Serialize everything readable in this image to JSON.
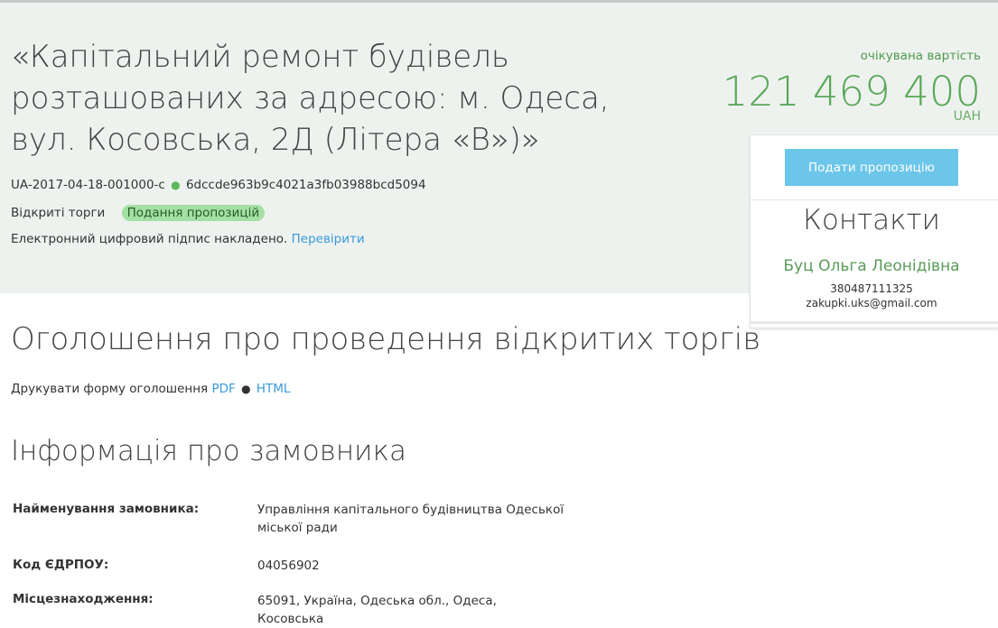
{
  "tender": {
    "title": "«Капітальний ремонт будівель розташованих за адресою: м. Одеса, вул. Косовська, 2Д (Літера «В»)»",
    "title_lines": [
      "«Капітальний ремонт будівель",
      "розташованих за адресою: м. Одеса,",
      "вул. Косовська, 2Д (Літера «В»)»"
    ],
    "tender_id": "UA-2017-04-18-001000-c",
    "hash": "6dccde963b9c4021a3fb03988bcd5094",
    "procedure_type": "Відкриті торги",
    "status": "Подання пропозицій",
    "signature_text": "Електронний цифровий підпис накладено.",
    "verify_link": "Перевірити"
  },
  "budget": {
    "label": "очікувана вартість",
    "amount": "121 469 400",
    "currency": "UAH"
  },
  "side_panel": {
    "bid_button": "Подати пропозицію",
    "contacts_title": "Контакти",
    "contact_name": "Буц Ольга Леонідівна",
    "phone": "380487111325",
    "email": "zakupki.uks@gmail.com"
  },
  "notice": {
    "heading": "Оголошення про проведення відкритих торгів",
    "print_label": "Друкувати форму оголошення",
    "pdf_link": "PDF",
    "html_link": "HTML"
  },
  "customer": {
    "heading": "Інформація про замовника",
    "fields": [
      {
        "label": "Найменування замовника:",
        "value": "Управління капітального будівництва Одеської міської ради"
      },
      {
        "label": "Код ЄДРПОУ:",
        "value": "04056902"
      },
      {
        "label": "Місцезнаходження:",
        "value": "65091, Україна, Одеська обл., Одеса, Косовська"
      }
    ]
  },
  "colors": {
    "header_bg": "#eef2ef",
    "accent_green": "#5aa85a",
    "button_blue": "#6cc6ea",
    "link_blue": "#3a99d8",
    "status_badge": "#a3e0a3"
  }
}
